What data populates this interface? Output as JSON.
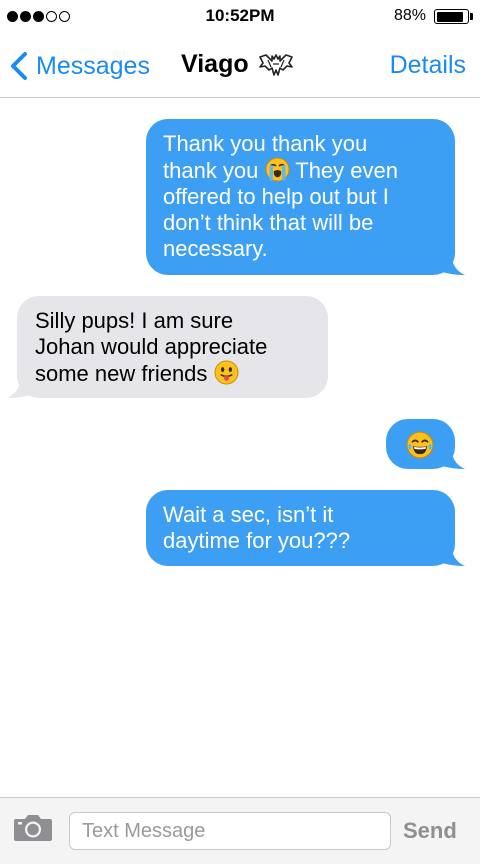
{
  "status_bar": {
    "signal_dots": [
      true,
      true,
      true,
      false,
      false
    ],
    "time": "10:52PM",
    "battery_percent": "88%",
    "battery_level": 0.88
  },
  "nav": {
    "back_label": "Messages",
    "title": "Viago",
    "title_icon": "bat-icon",
    "details_label": "Details"
  },
  "messages": [
    {
      "from": "me",
      "lines": [
        "Thank you thank you",
        "thank you",
        "They even",
        "offered to help out but I",
        "don’t think that will be",
        "necessary."
      ],
      "emoji": "loudly-crying-face"
    },
    {
      "from": "them",
      "lines": [
        "Silly pups! I am sure",
        "Johan would appreciate",
        "some new friends"
      ],
      "emoji": "face-with-tongue"
    },
    {
      "from": "me",
      "lines": [],
      "emoji": "face-with-tears-of-joy"
    },
    {
      "from": "me",
      "lines": [
        "Wait a sec, isn’t it",
        "daytime for you???"
      ]
    }
  ],
  "colors": {
    "accent": "#1a8bf2",
    "sent_bubble": "#3d9ff3",
    "received_bubble": "#e5e5ea",
    "emoji_yellow": "#fcc21b"
  },
  "input": {
    "placeholder": "Text Message",
    "value": "",
    "send_label": "Send",
    "camera_icon": "camera-icon"
  }
}
